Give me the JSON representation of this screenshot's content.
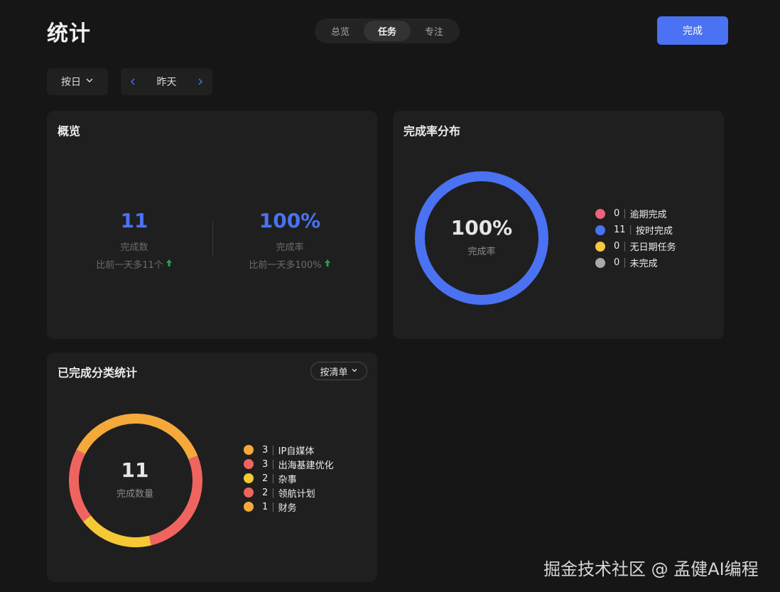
{
  "header": {
    "title": "统计",
    "tabs": [
      {
        "label": "总览",
        "active": false
      },
      {
        "label": "任务",
        "active": true
      },
      {
        "label": "专注",
        "active": false
      }
    ],
    "done_label": "完成"
  },
  "filters": {
    "period": "按日",
    "date": "昨天"
  },
  "overview": {
    "title": "概览",
    "completed": {
      "value": "11",
      "label": "完成数",
      "compare": "比前一天多11个"
    },
    "rate": {
      "value": "100%",
      "label": "完成率",
      "compare": "比前一天多100%"
    }
  },
  "rate_distribution": {
    "title": "完成率分布",
    "center_value": "100%",
    "center_label": "完成率",
    "items": [
      {
        "count": "0",
        "label": "逾期完成",
        "color": "#f0617a"
      },
      {
        "count": "11",
        "label": "按时完成",
        "color": "#4a72f2"
      },
      {
        "count": "0",
        "label": "无日期任务",
        "color": "#f5c842"
      },
      {
        "count": "0",
        "label": "未完成",
        "color": "#a9a9a9"
      }
    ]
  },
  "category_stats": {
    "title": "已完成分类统计",
    "filter_label": "按清单",
    "center_value": "11",
    "center_label": "完成数量",
    "items": [
      {
        "count": "3",
        "label": "IP自媒体",
        "color": "#f5a93b"
      },
      {
        "count": "3",
        "label": "出海基建优化",
        "color": "#f06460"
      },
      {
        "count": "2",
        "label": "杂事",
        "color": "#f5c834"
      },
      {
        "count": "2",
        "label": "领航计划",
        "color": "#f06460"
      },
      {
        "count": "1",
        "label": "财务",
        "color": "#f5a93b"
      }
    ]
  },
  "watermark": "掘金技术社区 @ 孟健AI编程"
}
